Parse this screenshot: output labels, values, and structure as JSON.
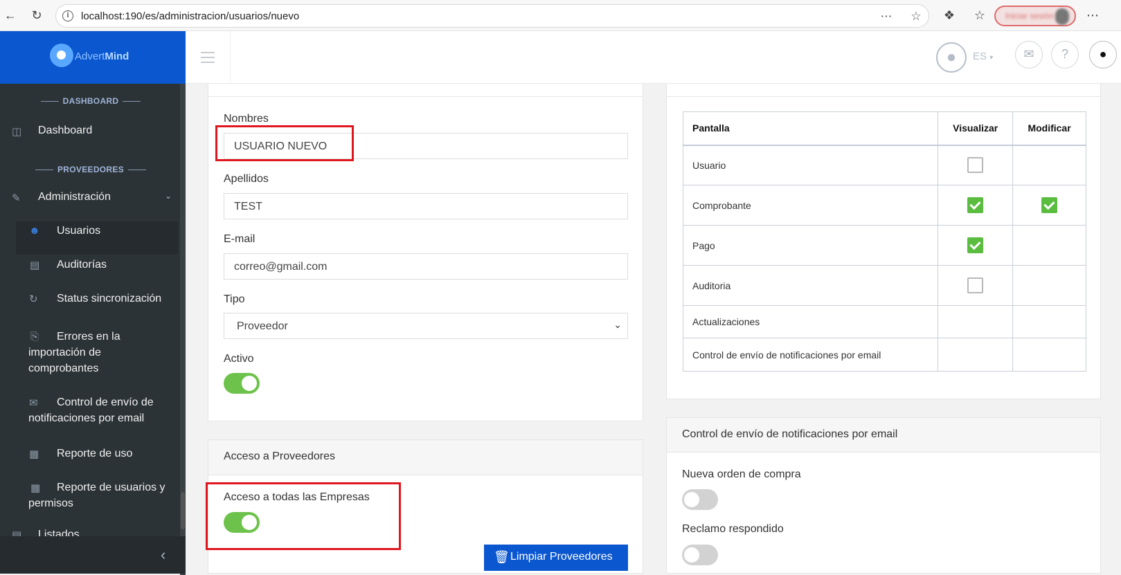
{
  "browser": {
    "url": "localhost:190/es/administracion/usuarios/nuevo",
    "icons": [
      "back-arrow-icon",
      "reload-icon",
      "info-icon",
      "read-aloud-icon",
      "favorite-star-icon",
      "extensions-icon",
      "favorites-icon",
      "more-icon"
    ],
    "profile_label": "Iniciar sesión"
  },
  "brand": {
    "name_a": "Advert",
    "name_b": "Mind"
  },
  "sidebar": {
    "section_dashboard": "DASHBOARD",
    "dashboard": "Dashboard",
    "section_proveedores": "PROVEEDORES",
    "administracion": "Administración",
    "usuarios": "Usuarios",
    "auditorias": "Auditorías",
    "status": "Status sincronización",
    "errores_1": "Errores en la",
    "errores_2": "importación de",
    "errores_3": "comprobantes",
    "control_1": "Control de envío de",
    "control_2": "notificaciones por email",
    "reporte_uso": "Reporte de uso",
    "reporte_usuarios_1": "Reporte de usuarios y",
    "reporte_usuarios_2": "permisos",
    "listados": "Listados"
  },
  "appbar": {
    "lang": "ES"
  },
  "form": {
    "nombres_label": "Nombres",
    "nombres_value": "USUARIO NUEVO",
    "apellidos_label": "Apellidos",
    "apellidos_value": "TEST",
    "email_label": "E-mail",
    "email_value": "correo@gmail.com",
    "tipo_label": "Tipo",
    "tipo_value": "Proveedor",
    "activo_label": "Activo",
    "activo_on": true
  },
  "acceso": {
    "title": "Acceso a Proveedores",
    "todas_label": "Acceso a todas las Empresas",
    "todas_on": true,
    "limpiar_button": "Limpiar Proveedores"
  },
  "permisos": {
    "headers": [
      "Pantalla",
      "Visualizar",
      "Modificar"
    ],
    "rows": [
      {
        "pantalla": "Usuario",
        "visualizar": "unchecked",
        "modificar": "none"
      },
      {
        "pantalla": "Comprobante",
        "visualizar": "checked",
        "modificar": "checked"
      },
      {
        "pantalla": "Pago",
        "visualizar": "checked",
        "modificar": "none"
      },
      {
        "pantalla": "Auditoria",
        "visualizar": "unchecked",
        "modificar": "none"
      },
      {
        "pantalla": "Actualizaciones",
        "visualizar": "none",
        "modificar": "none"
      },
      {
        "pantalla": "Control de envío de notificaciones por email",
        "visualizar": "none",
        "modificar": "none"
      }
    ]
  },
  "notificaciones": {
    "title": "Control de envío de notificaciones por email",
    "nueva_orden": "Nueva orden de compra",
    "nueva_orden_on": false,
    "reclamo": "Reclamo respondido",
    "reclamo_on": false
  },
  "colors": {
    "brand_blue": "#0b57d0",
    "sidebar": "#2c3336",
    "toggle_on": "#6cc24a",
    "check_on": "#5bbd3f",
    "highlight": "#e0161e"
  }
}
